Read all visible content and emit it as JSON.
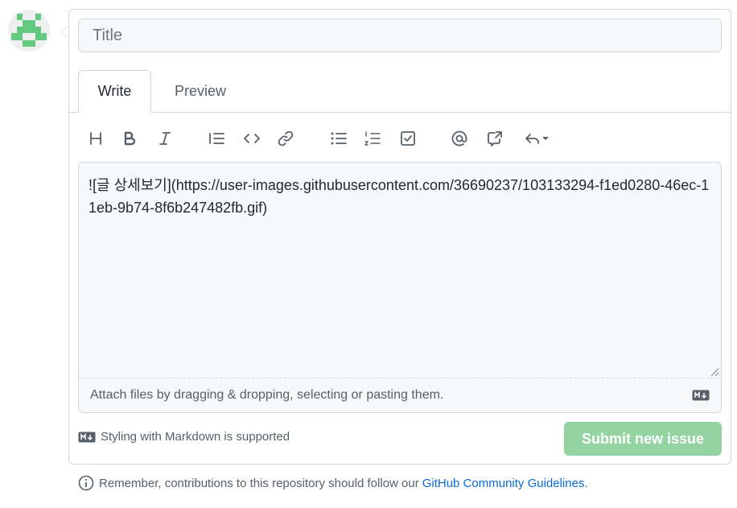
{
  "form": {
    "title_placeholder": "Title",
    "tabs": [
      {
        "label": "Write",
        "active": true
      },
      {
        "label": "Preview",
        "active": false
      }
    ],
    "toolbar": [
      {
        "icon": "heading-icon"
      },
      {
        "icon": "bold-icon"
      },
      {
        "icon": "italic-icon"
      },
      {
        "icon": "quote-icon"
      },
      {
        "icon": "code-icon"
      },
      {
        "icon": "link-icon"
      },
      {
        "icon": "unordered-list-icon"
      },
      {
        "icon": "ordered-list-icon"
      },
      {
        "icon": "task-list-icon"
      },
      {
        "icon": "mention-icon"
      },
      {
        "icon": "cross-reference-icon"
      },
      {
        "icon": "reply-icon"
      }
    ],
    "body_text": "![글 상세보기](https://user-images.githubusercontent.com/36690237/103133294-f1ed0280-46ec-11eb-9b74-8f6b247482fb.gif)",
    "attach_text": "Attach files by dragging & dropping, selecting or pasting them.",
    "markdown_note": "Styling with Markdown is supported",
    "submit_label": "Submit new issue"
  },
  "footer": {
    "prefix": "Remember, contributions to this repository should follow our",
    "link_text": "GitHub Community Guidelines",
    "suffix": "."
  },
  "colors": {
    "submit_disabled": "#94d3a2",
    "link": "#0969da",
    "avatar_green": "#64c981"
  }
}
